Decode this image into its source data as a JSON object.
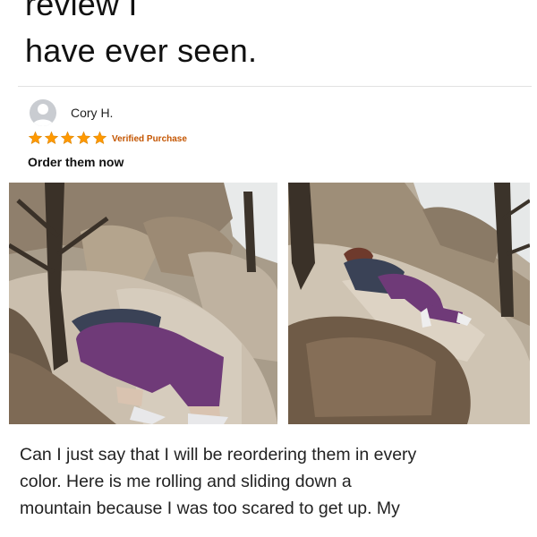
{
  "headline": {
    "line1": "review I",
    "line2": "have ever seen."
  },
  "review": {
    "author": "Cory H.",
    "rating": 5,
    "rating_max": 5,
    "star_color": "#ff9900",
    "verified_label": "Verified Purchase",
    "title": "Order them now",
    "body_lines": [
      "Can I just say that I will be reordering them in every",
      "color. Here is me rolling and sliding down a",
      "mountain because I was too scared to get up. My"
    ]
  },
  "icons": {
    "avatar": "person-icon",
    "star": "star-icon"
  },
  "colors": {
    "leggings": "#6f3a78",
    "verified": "#c45500"
  }
}
